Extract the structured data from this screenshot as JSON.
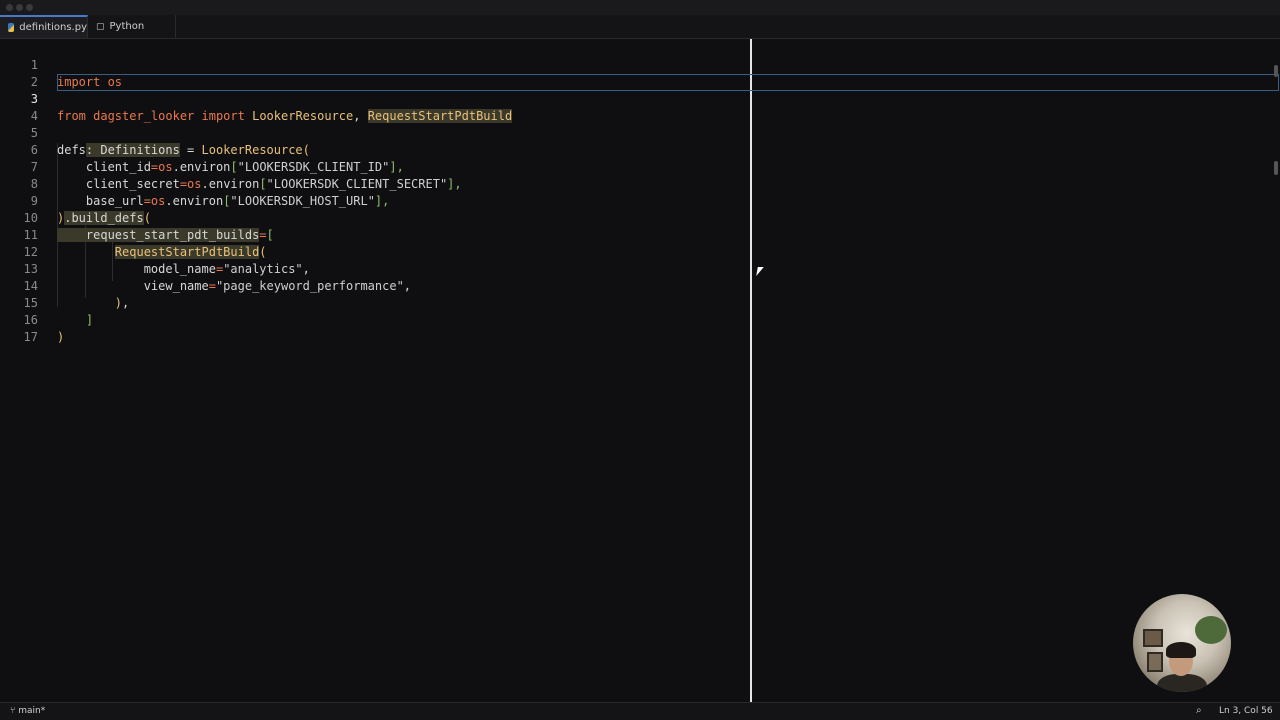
{
  "tabs": [
    {
      "label": "definitions.py",
      "icon": "python-file-icon",
      "active": true
    },
    {
      "label": "Python",
      "icon": "file-icon",
      "active": false
    }
  ],
  "editor": {
    "lines": [
      {
        "num": "1"
      },
      {
        "num": "2"
      },
      {
        "num": "3"
      },
      {
        "num": "4"
      },
      {
        "num": "5"
      },
      {
        "num": "6"
      },
      {
        "num": "7"
      },
      {
        "num": "8"
      },
      {
        "num": "9"
      },
      {
        "num": "10"
      },
      {
        "num": "11"
      },
      {
        "num": "12"
      },
      {
        "num": "13"
      },
      {
        "num": "14"
      },
      {
        "num": "15"
      },
      {
        "num": "16"
      },
      {
        "num": "17"
      }
    ],
    "tokens": {
      "l1_kw": "import",
      "l1_rest": " os",
      "l3_from": "from",
      "l3_mod": " dagster_looker ",
      "l3_imp": "import",
      "l3_sp": " ",
      "l3_cls1": "LookerResource",
      "l3_comma": ", ",
      "l3_cls2": "RequestStartPdtBuild",
      "l5_a": "defs",
      "l5_b": ": Definitions",
      "l5_c": " = ",
      "l5_d": "LookerResource",
      "l5_e": "(",
      "l6_a": "    client_id",
      "l6_b": "=os",
      "l6_c": ".environ",
      "l6_d": "[",
      "l6_e": "\"LOOKERSDK_CLIENT_ID\"",
      "l6_f": "],",
      "l7_a": "    client_secret",
      "l7_b": "=os",
      "l7_c": ".environ",
      "l7_d": "[",
      "l7_e": "\"LOOKERSDK_CLIENT_SECRET\"",
      "l7_f": "],",
      "l8_a": "    base_url",
      "l8_b": "=os",
      "l8_c": ".environ",
      "l8_d": "[",
      "l8_e": "\"LOOKERSDK_HOST_URL\"",
      "l8_f": "],",
      "l9_a": ")",
      "l9_b": ".build_defs",
      "l9_c": "(",
      "l10_a": "    request_start_pdt_builds",
      "l10_b": "=",
      "l10_c": "[",
      "l11_a": "        ",
      "l11_b": "RequestStartPdtBuild",
      "l11_c": "(",
      "l12_a": "            model_name",
      "l12_b": "=",
      "l12_c": "\"analytics\"",
      "l12_d": ",",
      "l13_a": "            view_name",
      "l13_b": "=",
      "l13_c": "\"page_keyword_performance\"",
      "l13_d": ",",
      "l14_a": "        ",
      "l14_b": ")",
      "l14_c": ",",
      "l15_a": "    ",
      "l15_b": "]",
      "l16_a": ")"
    }
  },
  "status": {
    "branch": "main*",
    "position": "Ln 3, Col 56"
  },
  "colors": {
    "background": "#0f0f11",
    "keyword": "#e9784f",
    "type": "#e8c07a",
    "bracket": "#8bc06a",
    "active_tab_accent": "#4a78c9"
  }
}
